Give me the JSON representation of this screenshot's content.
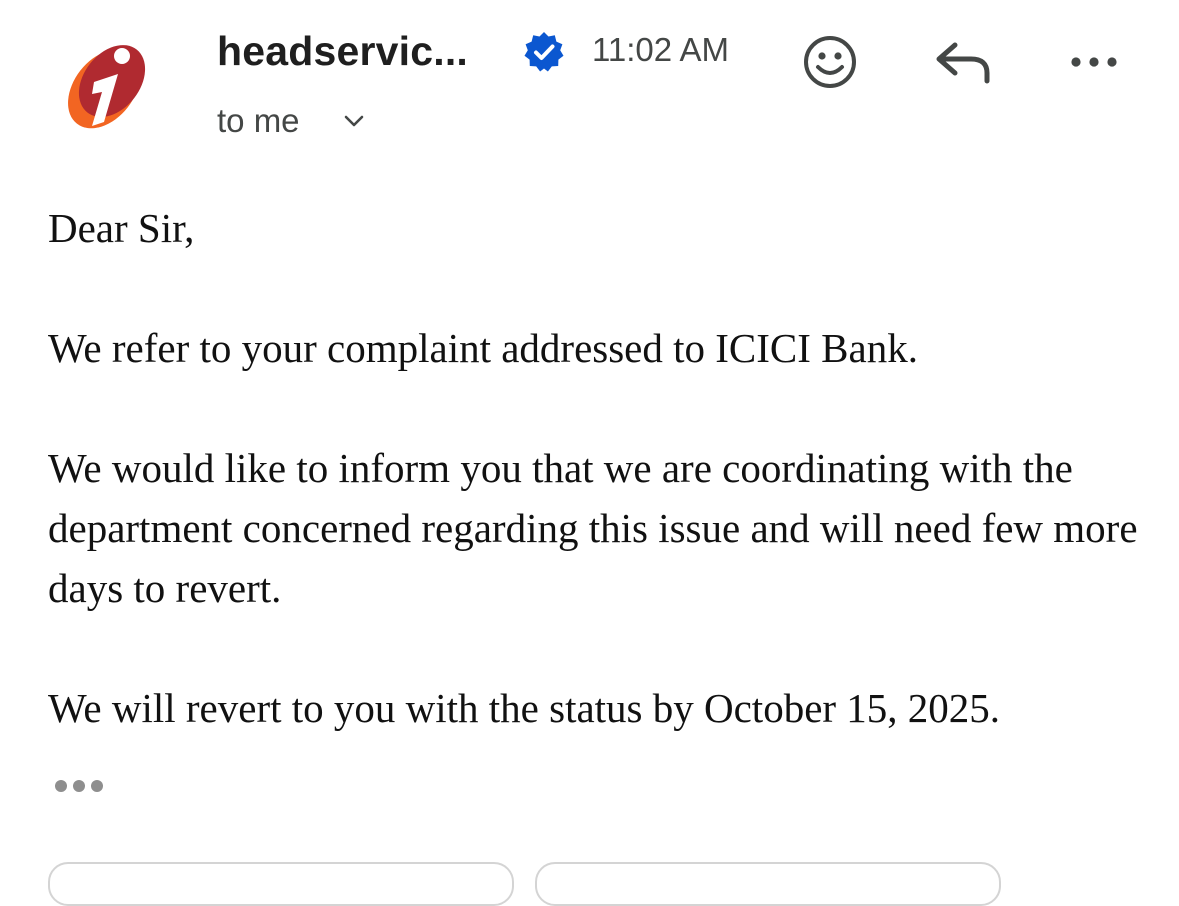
{
  "header": {
    "sender": "headservic...",
    "time": "11:02 AM",
    "recipient": "to me",
    "icons": {
      "avatar": "icici-logo",
      "verified": "verified-badge-icon",
      "chevron": "chevron-down-icon",
      "emoji": "emoji-reaction-icon",
      "reply": "reply-icon",
      "more": "more-options-icon"
    }
  },
  "email_body": {
    "greeting": "Dear Sir,",
    "paragraphs": [
      "We refer to your complaint addressed to ICICI Bank.",
      "We would like to inform you that we are coordinating with the department concerned regarding this issue and will need few more days to revert.",
      "We will revert to you with the status by October 15, 2025."
    ],
    "trimmed_content_icon": "show-trimmed-content-icon"
  },
  "colors": {
    "verified_blue": "#0b57d0",
    "logo_orange": "#f26522",
    "logo_red": "#b02a30",
    "secondary_text": "#444746"
  }
}
